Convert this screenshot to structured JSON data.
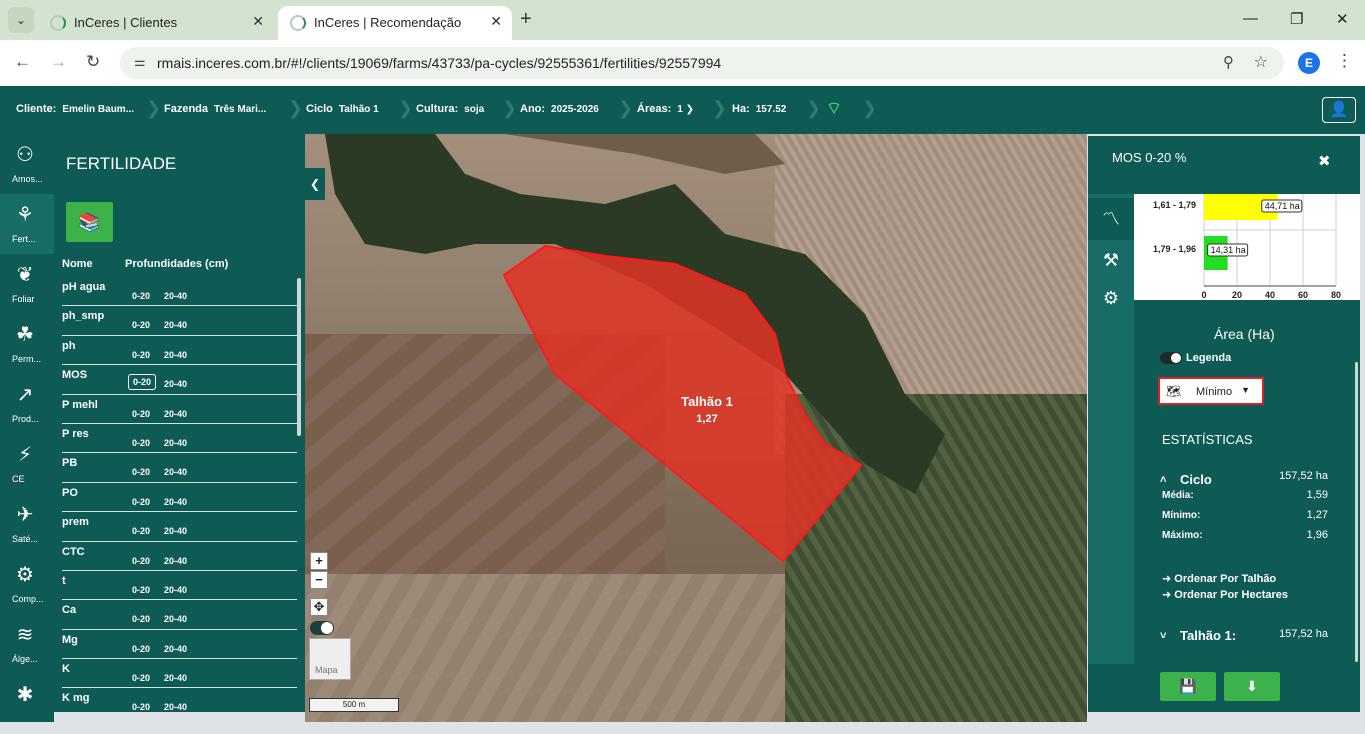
{
  "browser": {
    "dropdown_icon": "chevron-down-icon",
    "tabs": [
      {
        "title": "InCeres | Clientes",
        "active": false
      },
      {
        "title": "InCeres | Recomendação",
        "active": true
      }
    ],
    "new_tab": "+",
    "url": "rmais.inceres.com.br/#!/clients/19069/farms/43733/pa-cycles/92555361/fertilities/92557994",
    "profile_initial": "E",
    "window": {
      "minimize": "—",
      "maximize": "❐",
      "close": "✕"
    }
  },
  "header": {
    "crumbs": [
      {
        "key": "Cliente:",
        "value": "Emelin Baum..."
      },
      {
        "key": "Fazenda",
        "value": "Três Mari..."
      },
      {
        "key": "Ciclo",
        "value": "Talhão 1"
      },
      {
        "key": "Cultura:",
        "value": "soja"
      },
      {
        "key": "Ano:",
        "value": "2025-2026"
      },
      {
        "key": "Áreas:",
        "value": "1 ❯"
      },
      {
        "key": "Ha:",
        "value": "157.52"
      }
    ],
    "wifi_icon": "wifi-icon",
    "user_icon": "user-icon"
  },
  "rail": [
    {
      "label": "Amos...",
      "icon": "sample-icon",
      "glyph": "⚇"
    },
    {
      "label": "Fert...",
      "icon": "fertility-icon",
      "glyph": "⚘",
      "active": true
    },
    {
      "label": "Foliar",
      "icon": "leaf-icon",
      "glyph": "❦"
    },
    {
      "label": "Perm...",
      "icon": "seedlings-icon",
      "glyph": "☘"
    },
    {
      "label": "Prod...",
      "icon": "trend-icon",
      "glyph": "↗"
    },
    {
      "label": "CE",
      "icon": "plant-plug-icon",
      "glyph": "⚡"
    },
    {
      "label": "Saté...",
      "icon": "satellite-icon",
      "glyph": "✈"
    },
    {
      "label": "Comp...",
      "icon": "machine-icon",
      "glyph": "⚙"
    },
    {
      "label": "Álge...",
      "icon": "layers-icon",
      "glyph": "≋"
    },
    {
      "label": "",
      "icon": "bug-icon",
      "glyph": "✱"
    }
  ],
  "fertility": {
    "title": "FERTILIDADE",
    "add_icon": "book-open-icon",
    "col_name": "Nome",
    "col_depths": "Profundidades (cm)",
    "rows": [
      {
        "name": "pH agua",
        "d1": "0-20",
        "d2": "20-40"
      },
      {
        "name": "ph_smp",
        "d1": "0-20",
        "d2": "20-40"
      },
      {
        "name": "ph",
        "d1": "0-20",
        "d2": "20-40"
      },
      {
        "name": "MOS",
        "d1": "0-20",
        "d2": "20-40",
        "selected": true
      },
      {
        "name": "P mehl",
        "d1": "0-20",
        "d2": "20-40"
      },
      {
        "name": "P res",
        "d1": "0-20",
        "d2": "20-40"
      },
      {
        "name": "PB",
        "d1": "0-20",
        "d2": "20-40"
      },
      {
        "name": "PO",
        "d1": "0-20",
        "d2": "20-40"
      },
      {
        "name": "prem",
        "d1": "0-20",
        "d2": "20-40"
      },
      {
        "name": "CTC",
        "d1": "0-20",
        "d2": "20-40"
      },
      {
        "name": "t",
        "d1": "0-20",
        "d2": "20-40"
      },
      {
        "name": "Ca",
        "d1": "0-20",
        "d2": "20-40"
      },
      {
        "name": "Mg",
        "d1": "0-20",
        "d2": "20-40"
      },
      {
        "name": "K",
        "d1": "0-20",
        "d2": "20-40"
      },
      {
        "name": "K mg",
        "d1": "0-20",
        "d2": "20-40"
      }
    ]
  },
  "map": {
    "plot_name": "Talhão 1",
    "plot_value": "1,27",
    "zoom_in": "+",
    "zoom_out": "−",
    "layer_label": "Mapa",
    "scale_label": "500 m",
    "plot_color": "#e03426"
  },
  "panel": {
    "title": "MOS 0-20 %",
    "close": "✖",
    "tabs": [
      {
        "icon": "chart-line-icon",
        "glyph": "📈"
      },
      {
        "icon": "paint-roller-icon",
        "glyph": "🖌"
      },
      {
        "icon": "gears-icon",
        "glyph": "⚙"
      }
    ],
    "area_title": "Área (Ha)",
    "legend_label": "Legenda",
    "select_value": "Mínimo",
    "stats_title": "ESTATÍSTICAS",
    "cycle_label": "Ciclo",
    "cycle_value": "157,52 ha",
    "media_label": "Média:",
    "media_value": "1,59",
    "min_label": "Mínimo:",
    "min_value": "1,27",
    "max_label": "Máximo:",
    "max_value": "1,96",
    "order_plot": "Ordenar Por Talhão",
    "order_ha": "Ordenar Por Hectares",
    "plot_label": "Talhão 1:",
    "plot_value": "157,52 ha",
    "save_icon": "save-icon",
    "download_icon": "download-icon"
  },
  "chart_data": {
    "type": "bar",
    "orientation": "horizontal",
    "categories": [
      "1,61 - 1,79",
      "1,79 - 1,96"
    ],
    "values": [
      44.71,
      14.31
    ],
    "data_labels": [
      "44,71 ha",
      "14,31 ha"
    ],
    "colors": [
      "#ffff00",
      "#22dd22"
    ],
    "xticks": [
      0,
      20,
      40,
      60,
      80
    ],
    "xlim": [
      0,
      80
    ],
    "xlabel": "Área (Ha)",
    "grid": true
  }
}
